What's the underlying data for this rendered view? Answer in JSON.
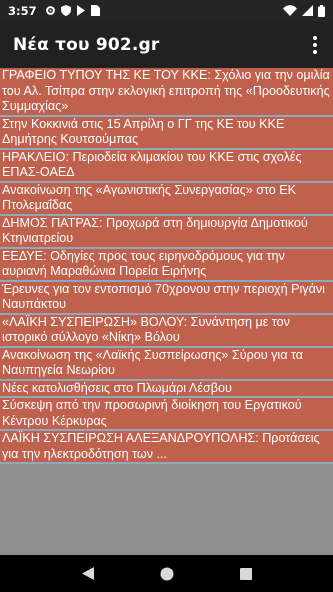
{
  "status": {
    "time": "3:57"
  },
  "app": {
    "title": "Νέα του 902.gr"
  },
  "items": [
    "ΓΡΑΦΕΙΟ ΤΥΠΟΥ ΤΗΣ ΚΕ ΤΟΥ ΚΚΕ: Σχόλιο για την ομιλία του Αλ. Τσίπρα στην εκλογική επιτροπή της «Προοδευτικής Συμμαχίας»",
    "Στην Κοκκινιά στις 15 Απρίλη ο ΓΓ της ΚΕ του ΚΚΕ Δημήτρης Κουτσούμπας",
    "ΗΡΑΚΛΕΙΟ: Περιοδεία κλιμακίου του ΚΚΕ στις σχολές ΕΠΑΣ-ΟΑΕΔ",
    "Ανακοίνωση της «Αγωνιστικής Συνεργασίας» στο ΕΚ Πτολεμαΐδας",
    "ΔΗΜΟΣ ΠΑΤΡΑΣ: Προχωρά στη δημιουργία Δημοτικού Κτηνιατρείου",
    "ΕΕΔΥΕ: Οδηγίες προς τους ειρηνοδρόμους για την αυριανή Μαραθώνια Πορεία Ειρήνης",
    "Έρευνες για τον εντοπισμό 70χρονου στην περιοχή Ριγάνι Ναυπάκτου",
    "«ΛΑΪΚΗ ΣΥΣΠΕΙΡΩΣΗ» ΒΟΛΟΥ: Συνάντηση με τον ιστορικό σύλλογο «Νίκη» Βόλου",
    "Ανακοίνωση της «Λαϊκής Συσπείρωσης» Σύρου για τα Ναυπηγεία Νεωρίου",
    "Νέες κατολισθήσεις στο Πλωμάρι Λέσβου",
    "Σύσκεψη από την προσωρινή διοίκηση του Εργατικού Κέντρου Κέρκυρας",
    "ΛΑΪΚΗ ΣΥΣΠΕΙΡΩΣΗ ΑΛΕΞΑΝΔΡΟΥΠΟΛΗΣ: Προτάσεις για την ηλεκτροδότηση των ..."
  ]
}
